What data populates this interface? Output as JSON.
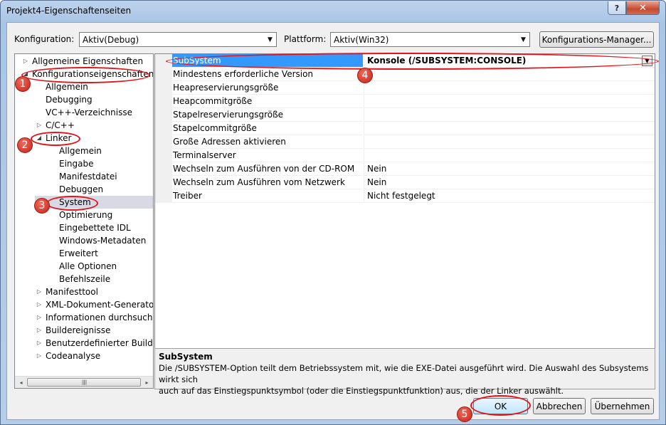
{
  "window": {
    "title": "Projekt4-Eigenschaftenseiten",
    "help_label": "?",
    "close_label": "✕"
  },
  "config": {
    "konfiguration_label": "Konfiguration:",
    "konfiguration_value": "Aktiv(Debug)",
    "plattform_label": "Plattform:",
    "plattform_value": "Aktiv(Win32)",
    "manager_button": "Konfigurations-Manager..."
  },
  "tree": {
    "items": [
      {
        "label": "Allgemeine Eigenschaften",
        "expander": "▷"
      },
      {
        "label": "Konfigurationseigenschaften",
        "expander": "◢"
      },
      {
        "label": "Allgemein",
        "expander": ""
      },
      {
        "label": "Debugging",
        "expander": ""
      },
      {
        "label": "VC++-Verzeichnisse",
        "expander": ""
      },
      {
        "label": "C/C++",
        "expander": "▷"
      },
      {
        "label": "Linker",
        "expander": "◢"
      },
      {
        "label": "Allgemein",
        "expander": ""
      },
      {
        "label": "Eingabe",
        "expander": ""
      },
      {
        "label": "Manifestdatei",
        "expander": ""
      },
      {
        "label": "Debuggen",
        "expander": ""
      },
      {
        "label": "System",
        "expander": ""
      },
      {
        "label": "Optimierung",
        "expander": ""
      },
      {
        "label": "Eingebettete IDL",
        "expander": ""
      },
      {
        "label": "Windows-Metadaten",
        "expander": ""
      },
      {
        "label": "Erweitert",
        "expander": ""
      },
      {
        "label": "Alle Optionen",
        "expander": ""
      },
      {
        "label": "Befehlszeile",
        "expander": ""
      },
      {
        "label": "Manifesttool",
        "expander": "▷"
      },
      {
        "label": "XML-Dokument-Generato",
        "expander": "▷"
      },
      {
        "label": "Informationen durchsuche",
        "expander": "▷"
      },
      {
        "label": "Buildereignisse",
        "expander": "▷"
      },
      {
        "label": "Benutzerdefinierter Buildsc",
        "expander": "▷"
      },
      {
        "label": "Codeanalyse",
        "expander": "▷"
      }
    ],
    "scroll_left": "◂",
    "scroll_right": "▸",
    "thumb_grip": "|||||"
  },
  "properties": {
    "rows": [
      {
        "name": "SubSystem",
        "value": "Konsole (/SUBSYSTEM:CONSOLE)"
      },
      {
        "name": "Mindestens erforderliche Version",
        "value": ""
      },
      {
        "name": "Heapreservierungsgröße",
        "value": ""
      },
      {
        "name": "Heapcommitgröße",
        "value": ""
      },
      {
        "name": "Stapelreservierungsgröße",
        "value": ""
      },
      {
        "name": "Stapelcommitgröße",
        "value": ""
      },
      {
        "name": "Große Adressen aktivieren",
        "value": ""
      },
      {
        "name": "Terminalserver",
        "value": ""
      },
      {
        "name": "Wechseln zum Ausführen von der CD-ROM",
        "value": "Nein"
      },
      {
        "name": "Wechseln zum Ausführen vom Netzwerk",
        "value": "Nein"
      },
      {
        "name": "Treiber",
        "value": "Nicht festgelegt"
      }
    ],
    "dropdown_arrow": "▼"
  },
  "description": {
    "title": "SubSystem",
    "text_line1": "Die /SUBSYSTEM-Option teilt dem Betriebssystem mit, wie die EXE-Datei ausgeführt wird. Die Auswahl des Subsystems wirkt sich",
    "text_line2": "auch auf das Einstiegspunktsymbol (oder die Einstiegspunktfunktion) aus, die der Linker auswählt."
  },
  "buttons": {
    "ok": "OK",
    "cancel": "Abbrechen",
    "apply": "Übernehmen"
  },
  "annotations": {
    "badge1": "1",
    "badge2": "2",
    "badge3": "3",
    "badge4": "4",
    "badge5": "5",
    "color": "#e0151b"
  }
}
